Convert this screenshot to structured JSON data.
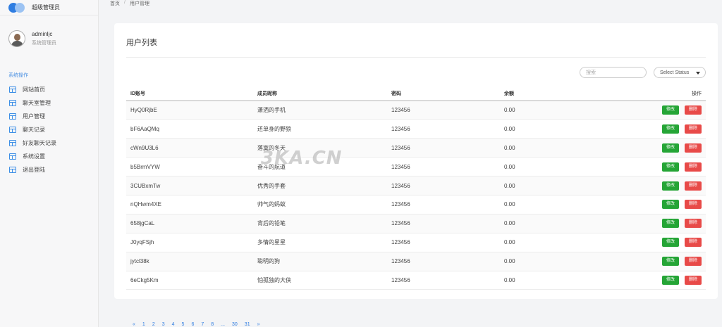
{
  "app": {
    "brand_title": "超级管理员",
    "user_name": "adminljc",
    "user_role": "系统管理员"
  },
  "sidebar": {
    "section_label": "系统操作",
    "items": [
      {
        "label": "网站首页"
      },
      {
        "label": "聊天室管理"
      },
      {
        "label": "用户管理"
      },
      {
        "label": "聊天记录"
      },
      {
        "label": "好友聊天记录"
      },
      {
        "label": "系统设置"
      },
      {
        "label": "退出登陆"
      }
    ]
  },
  "breadcrumb": {
    "home": "首页",
    "separator": "/",
    "current": "用户管理"
  },
  "main": {
    "title": "用户列表",
    "search_placeholder": "搜索",
    "status_select": "Select Status",
    "columns": {
      "id": "ID账号",
      "nickname": "成员昵称",
      "password": "密码",
      "balance": "余额",
      "actions": "操作"
    },
    "edit_label": "修改",
    "delete_label": "删除",
    "rows": [
      {
        "id": "HyQ0RjbE",
        "nickname": "潇洒的手机",
        "password": "123456",
        "balance": "0.00"
      },
      {
        "id": "bF6AaQMq",
        "nickname": "还单身的野狼",
        "password": "123456",
        "balance": "0.00"
      },
      {
        "id": "cWn9U3L6",
        "nickname": "落寞的冬天",
        "password": "123456",
        "balance": "0.00"
      },
      {
        "id": "b5BrmVYW",
        "nickname": "奋斗的航道",
        "password": "123456",
        "balance": "0.00"
      },
      {
        "id": "3CUBxmTw",
        "nickname": "优秀的手套",
        "password": "123456",
        "balance": "0.00"
      },
      {
        "id": "nQHwm4XE",
        "nickname": "帅气的蚂蚁",
        "password": "123456",
        "balance": "0.00"
      },
      {
        "id": "658jgCaL",
        "nickname": "背后的铅笔",
        "password": "123456",
        "balance": "0.00"
      },
      {
        "id": "J0yqFSjh",
        "nickname": "多情的星星",
        "password": "123456",
        "balance": "0.00"
      },
      {
        "id": "jytcl38k",
        "nickname": "聪明的狗",
        "password": "123456",
        "balance": "0.00"
      },
      {
        "id": "6eCkg5Km",
        "nickname": "怕孤独的大侠",
        "password": "123456",
        "balance": "0.00"
      }
    ]
  },
  "watermark": "3KA.CN",
  "pagination": [
    "«",
    "1",
    "2",
    "3",
    "4",
    "5",
    "6",
    "7",
    "8",
    "...",
    "30",
    "31",
    "»"
  ]
}
